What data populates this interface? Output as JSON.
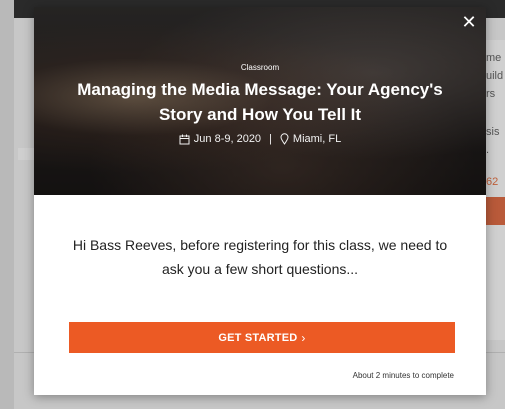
{
  "modal": {
    "category": "Classroom",
    "title": "Managing the Media Message: Your Agency's Story and How You Tell It",
    "date": "Jun 8-9, 2020",
    "separator": "|",
    "location": "Miami, FL",
    "question": "Hi Bass Reeves, before registering for this class, we need to ask you a few short questions...",
    "start_label": "GET STARTED",
    "time_note": "About 2 minutes to complete"
  },
  "background": {
    "right_texts": [
      "me",
      "uild",
      "rs",
      "sis",
      ".",
      "62"
    ]
  },
  "colors": {
    "accent": "#ec5a24",
    "hero_overlay": "#2b2726"
  },
  "icons": {
    "close": "close-icon",
    "calendar": "calendar-icon",
    "location": "map-pin-icon",
    "chevron": "chevron-right-icon"
  }
}
